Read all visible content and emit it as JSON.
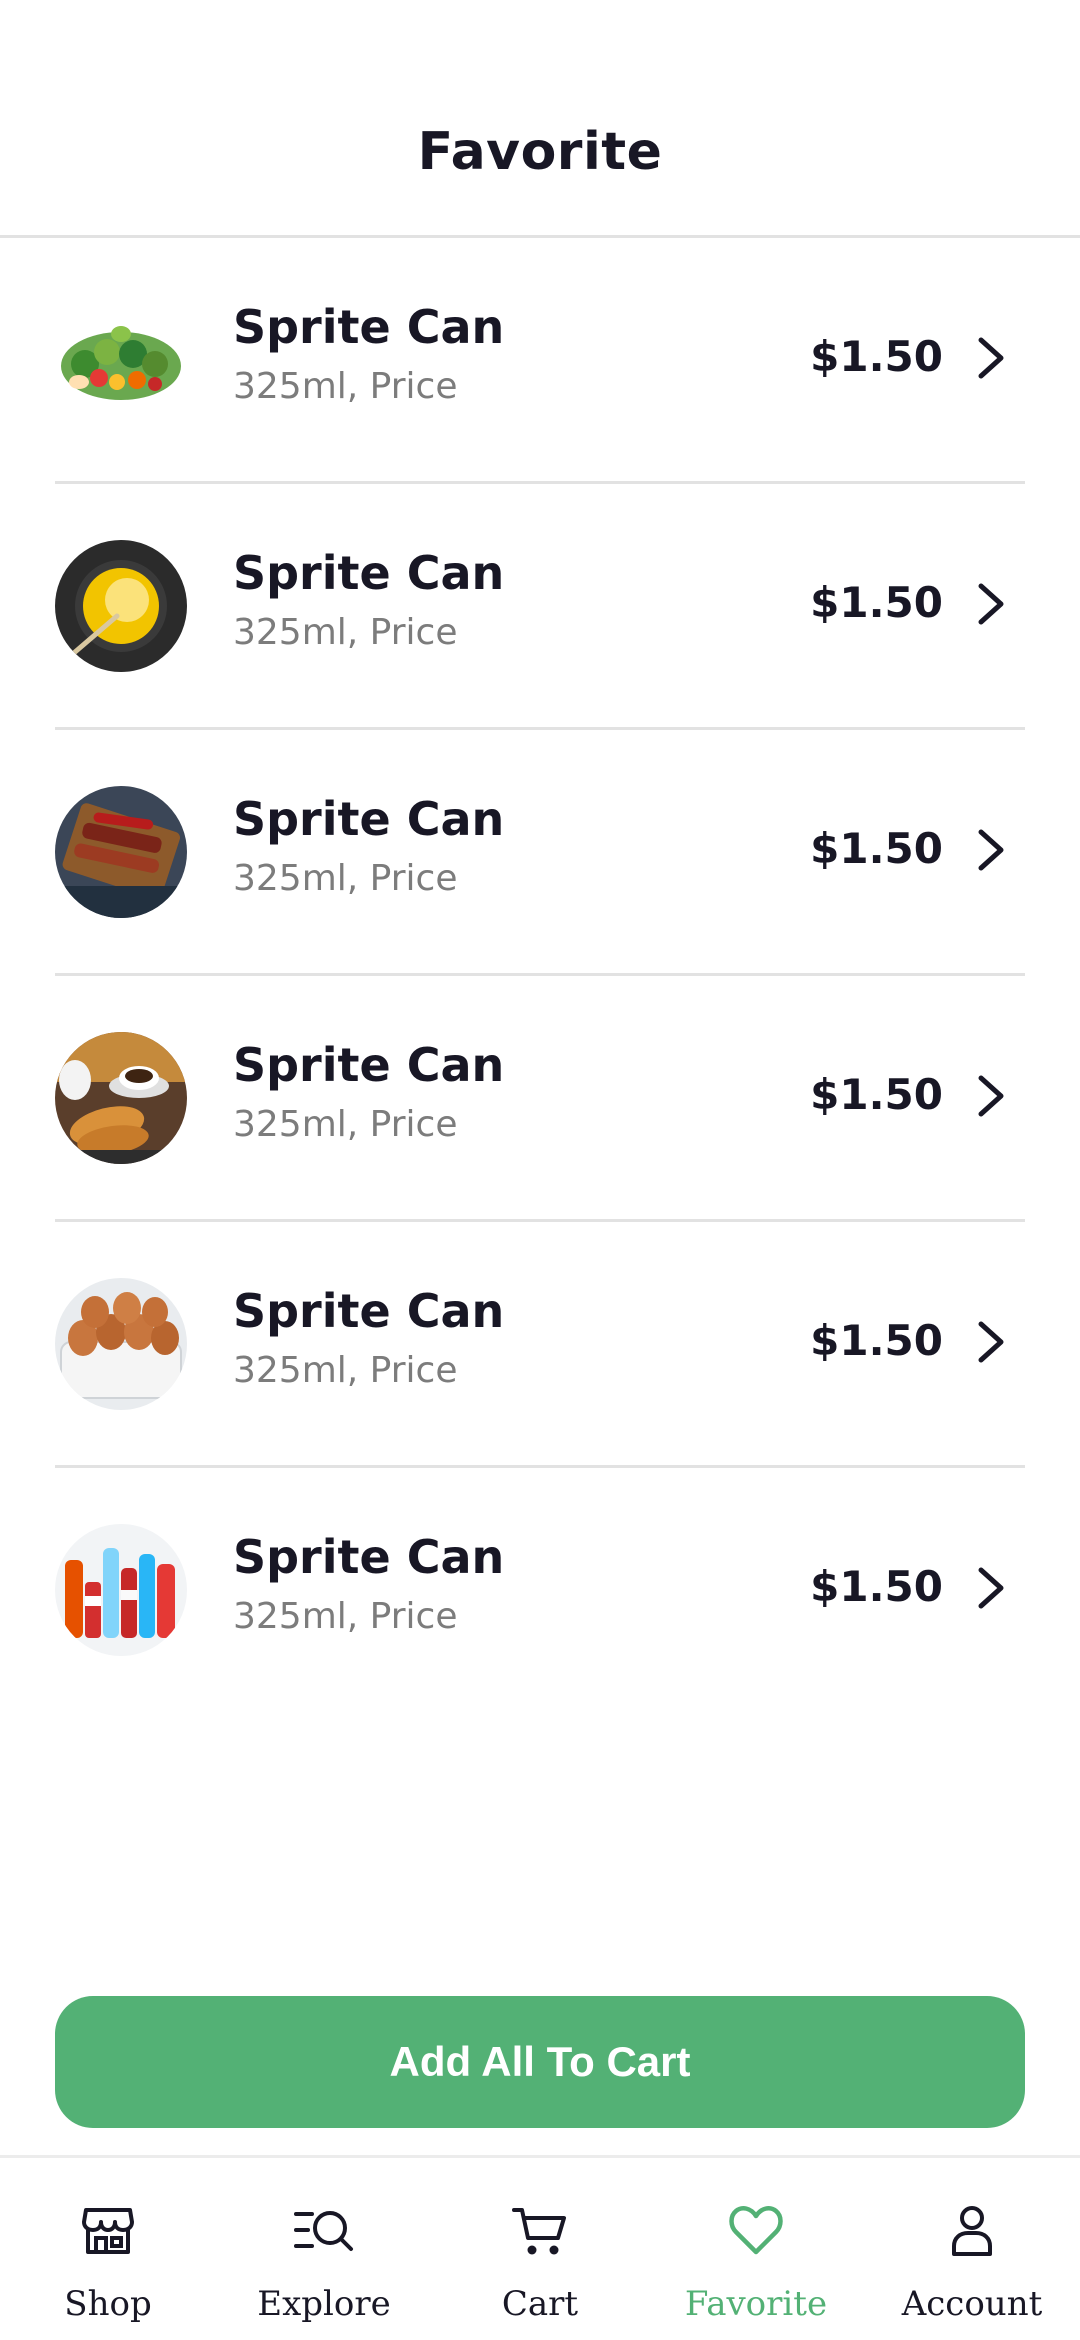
{
  "header": {
    "title": "Favorite"
  },
  "items": [
    {
      "name": "Sprite Can",
      "detail": "325ml, Price",
      "price": "$1.50",
      "image": "vegetables-image"
    },
    {
      "name": "Sprite Can",
      "detail": "325ml, Price",
      "price": "$1.50",
      "image": "oil-bowl-image"
    },
    {
      "name": "Sprite Can",
      "detail": "325ml, Price",
      "price": "$1.50",
      "image": "meat-grill-image"
    },
    {
      "name": "Sprite Can",
      "detail": "325ml, Price",
      "price": "$1.50",
      "image": "croissant-coffee-image"
    },
    {
      "name": "Sprite Can",
      "detail": "325ml, Price",
      "price": "$1.50",
      "image": "eggs-image"
    },
    {
      "name": "Sprite Can",
      "detail": "325ml, Price",
      "price": "$1.50",
      "image": "beverages-image"
    }
  ],
  "add_all_button": {
    "label": "Add All To Cart"
  },
  "nav": {
    "items": [
      {
        "label": "Shop",
        "icon": "store-icon"
      },
      {
        "label": "Explore",
        "icon": "explore-search-icon"
      },
      {
        "label": "Cart",
        "icon": "cart-icon"
      },
      {
        "label": "Favorite",
        "icon": "heart-icon"
      },
      {
        "label": "Account",
        "icon": "user-icon"
      }
    ],
    "active": "Favorite"
  },
  "colors": {
    "accent": "#53b175",
    "text": "#181725",
    "muted": "#7c7c7c",
    "divider": "#e2e2e2"
  }
}
